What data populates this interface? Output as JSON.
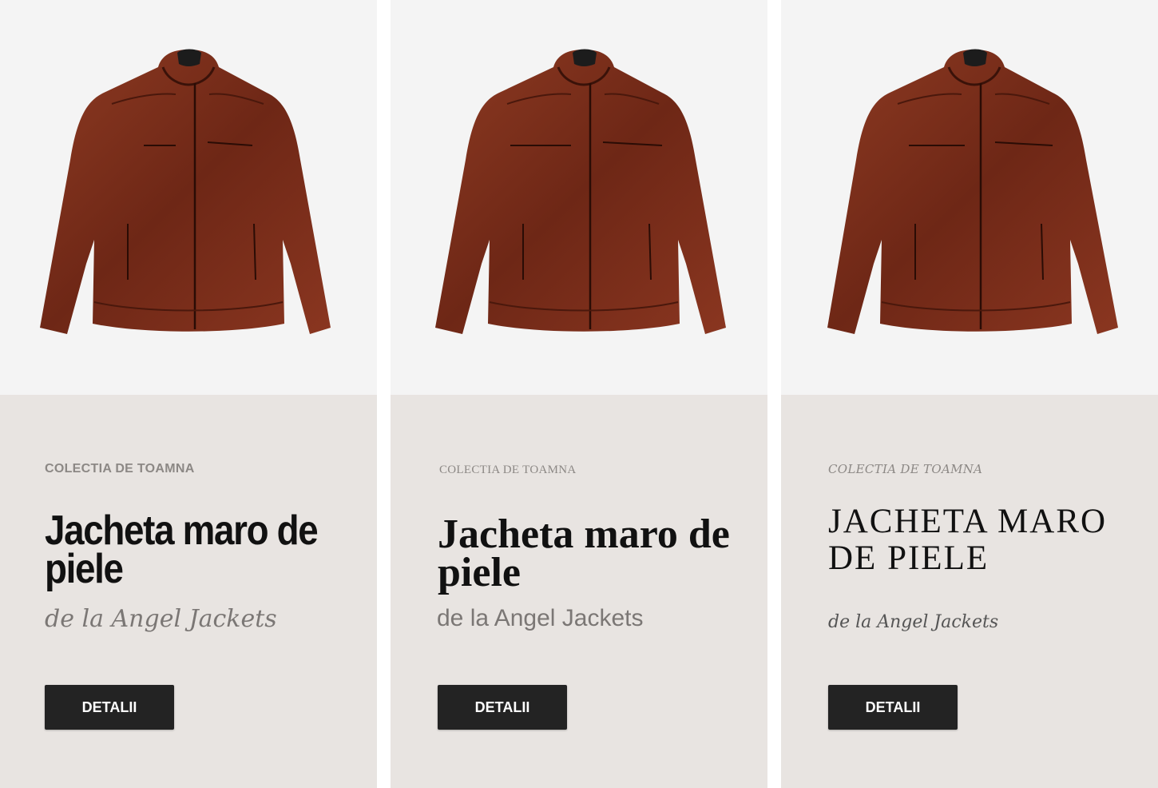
{
  "cards": [
    {
      "image": "leather-jacket-photo",
      "tagline": "COLECTIA DE TOAMNA",
      "title": "Jacheta maro de piele",
      "subtitle": "de la Angel Jackets",
      "button": "DETALII"
    },
    {
      "image": "leather-jacket-photo",
      "tagline": "COLECTIA DE TOAMNA",
      "title": "Jacheta maro de piele",
      "subtitle": "de la Angel Jackets",
      "button": "DETALII"
    },
    {
      "image": "leather-jacket-photo",
      "tagline": "COLECTIA DE TOAMNA",
      "title": "JACHETA MARO DE PIELE",
      "subtitle": "de la Angel Jackets",
      "button": "DETALII"
    }
  ],
  "colors": {
    "card_background": "#e8e4e1",
    "photo_background": "#f4f4f4",
    "button_background": "#232323",
    "jacket": "#7a2e1c"
  }
}
